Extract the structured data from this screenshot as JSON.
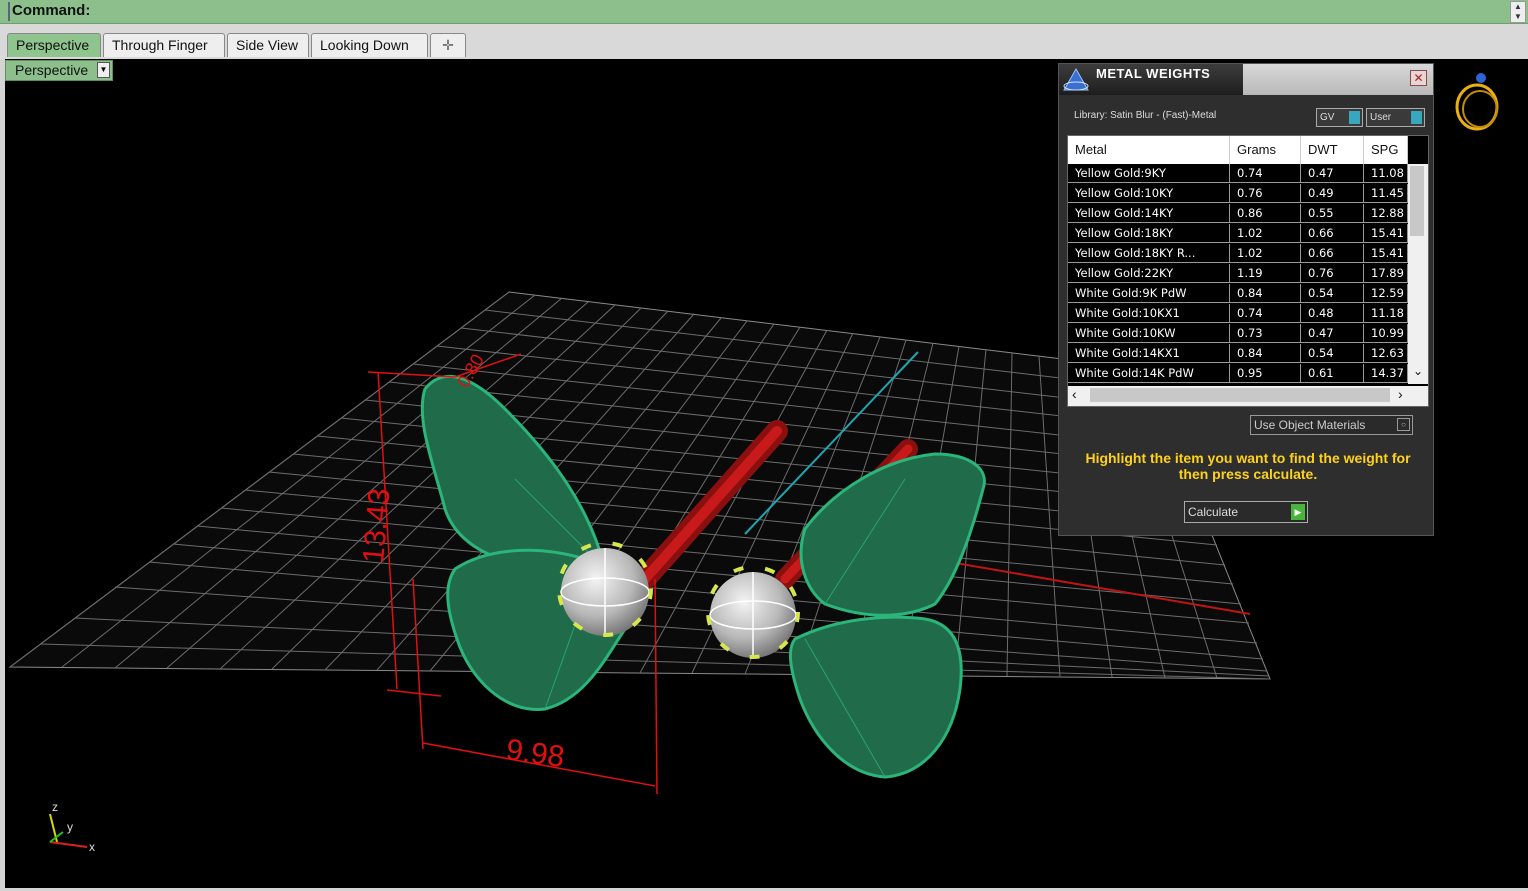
{
  "command": {
    "label": "Command:"
  },
  "tabs": [
    "Perspective",
    "Through Finger",
    "Side View",
    "Looking Down"
  ],
  "viewport": {
    "name": "Perspective",
    "dimensions": [
      "13.43",
      "9.98",
      "0.80"
    ],
    "axes": {
      "z": "z",
      "y": "y",
      "x": "x"
    }
  },
  "panel": {
    "title": "METAL WEIGHTS",
    "library": "Library: Satin Blur - (Fast)-Metal",
    "toggle_gv": "GV",
    "toggle_user": "User",
    "columns": [
      "Metal",
      "Grams",
      "DWT",
      "SPG"
    ],
    "rows": [
      [
        "Yellow Gold:9KY",
        "0.74",
        "0.47",
        "11.08"
      ],
      [
        "Yellow Gold:10KY",
        "0.76",
        "0.49",
        "11.45"
      ],
      [
        "Yellow Gold:14KY",
        "0.86",
        "0.55",
        "12.88"
      ],
      [
        "Yellow Gold:18KY",
        "1.02",
        "0.66",
        "15.41"
      ],
      [
        "Yellow Gold:18KY R...",
        "1.02",
        "0.66",
        "15.41"
      ],
      [
        "Yellow Gold:22KY",
        "1.19",
        "0.76",
        "17.89"
      ],
      [
        "White Gold:9K PdW",
        "0.84",
        "0.54",
        "12.59"
      ],
      [
        "White Gold:10KX1",
        "0.74",
        "0.48",
        "11.18"
      ],
      [
        "White Gold:10KW",
        "0.73",
        "0.47",
        "10.99"
      ],
      [
        "White Gold:14KX1",
        "0.84",
        "0.54",
        "12.63"
      ],
      [
        "White Gold:14K PdW",
        "0.95",
        "0.61",
        "14.37"
      ]
    ],
    "use_object_materials": "Use Object Materials",
    "hint": "Highlight the item you want to find the weight for then press calculate.",
    "calculate": "Calculate"
  }
}
